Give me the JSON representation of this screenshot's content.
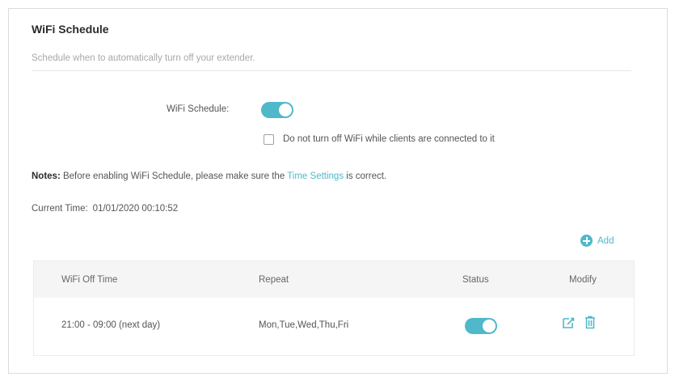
{
  "page": {
    "title": "WiFi Schedule",
    "subtitle": "Schedule when to automatically turn off your extender.",
    "schedule_label": "WiFi Schedule:",
    "checkbox_label": "Do not turn off WiFi while clients are connected to it",
    "notes_prefix": "Notes:",
    "notes_text": " Before enabling WiFi Schedule, please make sure the ",
    "notes_link": "Time Settings",
    "notes_suffix": " is correct.",
    "current_time_label": "Current Time:",
    "current_time_value": "01/01/2020 00:10:52",
    "add_label": "Add"
  },
  "table": {
    "headers": [
      "WiFi Off Time",
      "Repeat",
      "Status",
      "Modify"
    ],
    "rows": [
      {
        "off_time": "21:00 - 09:00 (next day)",
        "repeat": "Mon,Tue,Wed,Thu,Fri",
        "status": "on"
      }
    ]
  },
  "colors": {
    "accent": "#4fb8ca",
    "header_bg": "#f5f5f5",
    "border": "#dcdcdc"
  },
  "icons": [
    "add-icon",
    "edit-icon",
    "delete-icon"
  ]
}
